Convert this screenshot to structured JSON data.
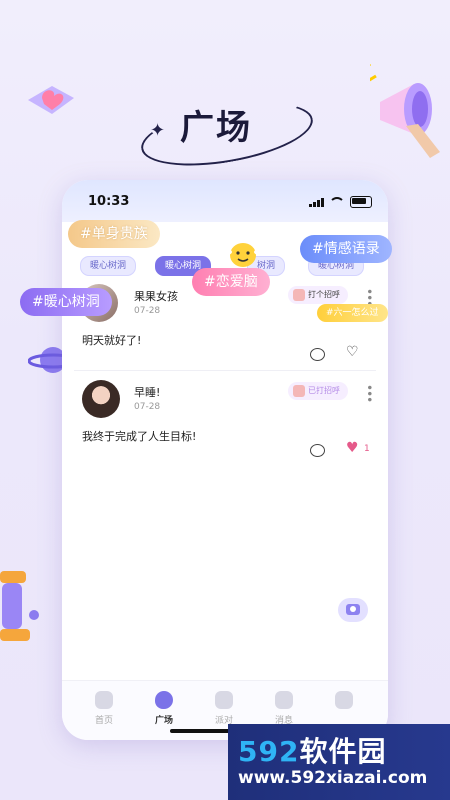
{
  "heading": {
    "title": "广场"
  },
  "status_bar": {
    "time": "10:33"
  },
  "filter_tags": [
    {
      "label": "暖心树洞",
      "active": false
    },
    {
      "label": "暖心树洞",
      "active": true
    },
    {
      "label": "树洞",
      "active": false
    },
    {
      "label": "暖心树洞",
      "active": false
    }
  ],
  "bubbles": {
    "b1": "#单身贵族",
    "b2": "#情感语录",
    "b3": "#恋爱脑",
    "b4": "#暖心树洞",
    "b5": "#六一怎么过"
  },
  "posts": [
    {
      "name": "果果女孩",
      "date": "07-28",
      "action": "打个招呼",
      "body": "明天就好了!",
      "liked": false,
      "likes": ""
    },
    {
      "name": "早睡!",
      "date": "07-28",
      "action": "已打招呼",
      "body": "我终于完成了人生目标!",
      "liked": true,
      "likes": "1"
    }
  ],
  "tabs": [
    {
      "label": "首页",
      "active": false
    },
    {
      "label": "广场",
      "active": true
    },
    {
      "label": "派对",
      "active": false
    },
    {
      "label": "消息",
      "active": false
    },
    {
      "label": "",
      "active": false
    }
  ],
  "watermark": {
    "brand_num": "592",
    "brand_text": "软件园",
    "url": "www.592xiazai.com"
  },
  "colors": {
    "accent": "#7b72e8",
    "like": "#e55a8a"
  }
}
